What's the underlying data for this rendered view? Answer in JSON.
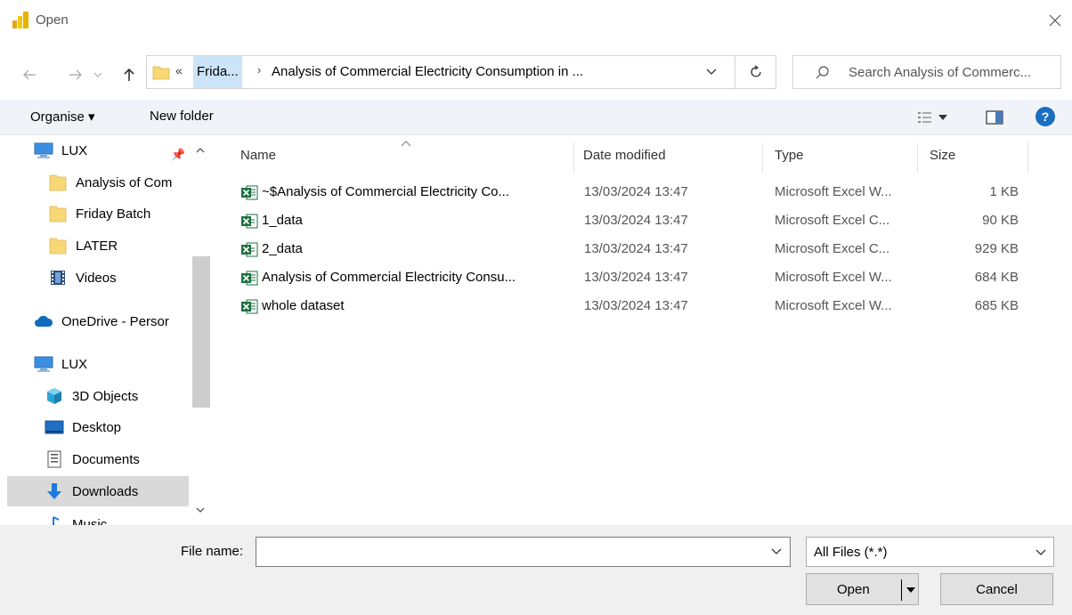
{
  "window": {
    "title": "Open"
  },
  "address": {
    "crumb_prefix": "«",
    "crumb1": "Frida...",
    "crumb_separator": "›",
    "crumb2": "Analysis of Commercial Electricity Consumption in ..."
  },
  "search": {
    "placeholder": "Search Analysis of Commerc..."
  },
  "toolbar": {
    "organise": "Organise ▾",
    "new_folder": "New folder"
  },
  "sidebar": {
    "items": [
      {
        "label": "LUX",
        "icon": "computer-icon"
      },
      {
        "label": "Analysis of Com",
        "icon": "folder-icon"
      },
      {
        "label": "Friday Batch",
        "icon": "folder-icon"
      },
      {
        "label": "LATER",
        "icon": "folder-icon"
      },
      {
        "label": "Videos",
        "icon": "videos-icon"
      },
      {
        "label": "OneDrive - Persor",
        "icon": "cloud-icon"
      },
      {
        "label": "LUX",
        "icon": "computer-icon"
      },
      {
        "label": "3D Objects",
        "icon": "cube-icon"
      },
      {
        "label": "Desktop",
        "icon": "desktop-icon"
      },
      {
        "label": "Documents",
        "icon": "documents-icon"
      },
      {
        "label": "Downloads",
        "icon": "download-icon",
        "selected": true
      },
      {
        "label": "Music",
        "icon": "music-icon"
      }
    ]
  },
  "columns": {
    "name": "Name",
    "date": "Date modified",
    "type": "Type",
    "size": "Size"
  },
  "files": [
    {
      "name": "~$Analysis of Commercial Electricity Co...",
      "date": "13/03/2024 13:47",
      "type": "Microsoft Excel W...",
      "size": "1 KB",
      "kind": "xlsx"
    },
    {
      "name": "1_data",
      "date": "13/03/2024 13:47",
      "type": "Microsoft Excel C...",
      "size": "90 KB",
      "kind": "csv"
    },
    {
      "name": "2_data",
      "date": "13/03/2024 13:47",
      "type": "Microsoft Excel C...",
      "size": "929 KB",
      "kind": "csv"
    },
    {
      "name": "Analysis of Commercial Electricity Consu...",
      "date": "13/03/2024 13:47",
      "type": "Microsoft Excel W...",
      "size": "684 KB",
      "kind": "xlsx"
    },
    {
      "name": "whole dataset",
      "date": "13/03/2024 13:47",
      "type": "Microsoft Excel W...",
      "size": "685 KB",
      "kind": "xlsx"
    }
  ],
  "bottom": {
    "filename_label": "File name:",
    "filename_value": "",
    "filter": "All Files (*.*)",
    "open": "Open",
    "cancel": "Cancel"
  },
  "colors": {
    "excel_green": "#1d6f42",
    "folder_yellow": "#f8d775",
    "selection_blue": "#cce4f7",
    "help_blue": "#1b6ec2",
    "selected_nav": "#d9d9d9"
  }
}
